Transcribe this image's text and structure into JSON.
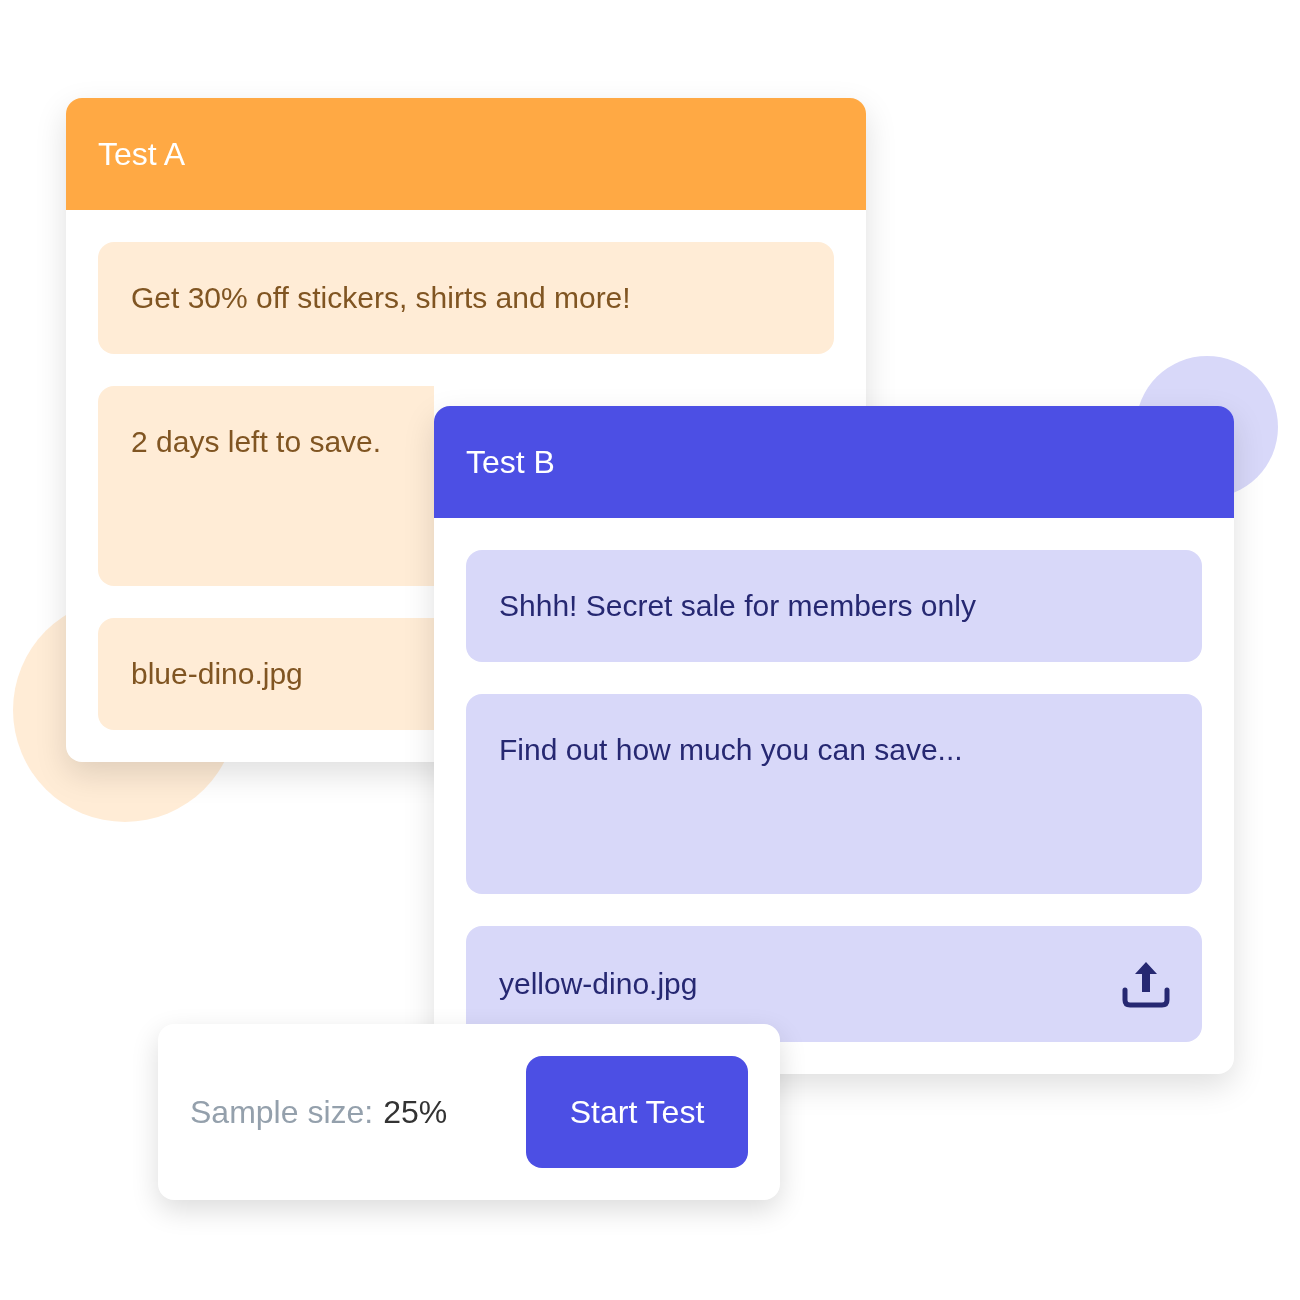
{
  "tests": [
    {
      "title": "Test A",
      "color": "#ffa944",
      "fields": [
        {
          "kind": "line",
          "value": "Get 30% off stickers, shirts and more!"
        },
        {
          "kind": "area",
          "value": "2 days left to save."
        },
        {
          "kind": "line",
          "value": "blue-dino.jpg"
        }
      ]
    },
    {
      "title": "Test B",
      "color": "#4c4fe4",
      "fields": [
        {
          "kind": "line",
          "value": "Shhh! Secret sale for members only"
        },
        {
          "kind": "area",
          "value": "Find out how much you can save..."
        },
        {
          "kind": "file",
          "value": "yellow-dino.jpg"
        }
      ]
    }
  ],
  "footer": {
    "label": "Sample size:",
    "value": "25%",
    "button": "Start Test"
  }
}
